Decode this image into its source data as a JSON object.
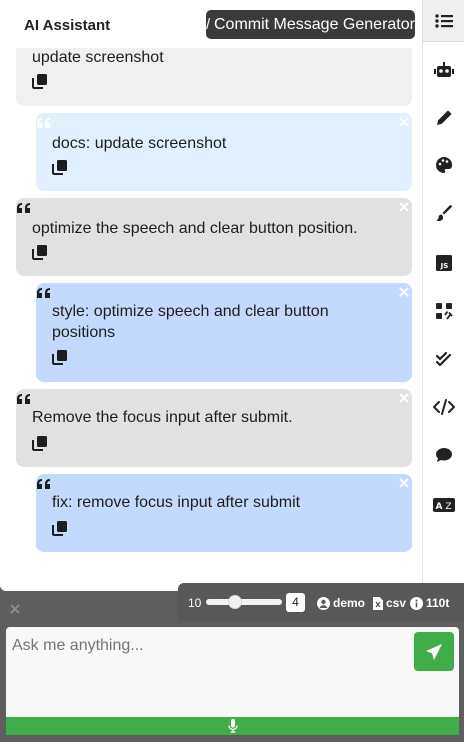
{
  "header": {
    "title": "AI Assistant",
    "generator_label": "Commit Message Generator"
  },
  "messages": [
    {
      "role": "user",
      "text": "update screenshot"
    },
    {
      "role": "assistant",
      "text": "docs: update screenshot"
    },
    {
      "role": "user",
      "text": "optimize the speech and clear button position."
    },
    {
      "role": "assistant",
      "text": "style: optimize speech and clear button positions"
    },
    {
      "role": "user",
      "text": "Remove the focus input after submit."
    },
    {
      "role": "assistant",
      "text": "fix: remove focus input after submit"
    }
  ],
  "sidebar": {
    "items": [
      {
        "icon": "list-icon",
        "active": true
      },
      {
        "icon": "robot-icon"
      },
      {
        "icon": "pencil-icon"
      },
      {
        "icon": "palette-icon"
      },
      {
        "icon": "brush-icon"
      },
      {
        "icon": "js-icon"
      },
      {
        "icon": "code-review-icon"
      },
      {
        "icon": "double-check-icon"
      },
      {
        "icon": "code-icon"
      },
      {
        "icon": "chat-icon"
      },
      {
        "icon": "translate-icon"
      }
    ]
  },
  "controls": {
    "slider_min_label": "10",
    "slider_value": "4",
    "user_label": "demo",
    "csv_label": "csv",
    "tokens_label": "110t"
  },
  "input": {
    "placeholder": "Ask me anything..."
  },
  "colors": {
    "send_green": "#3fae49",
    "assistant_bubble": "#c4d9fe",
    "user_bubble": "#e1e1e1",
    "dark_button": "#3a3a3a"
  }
}
